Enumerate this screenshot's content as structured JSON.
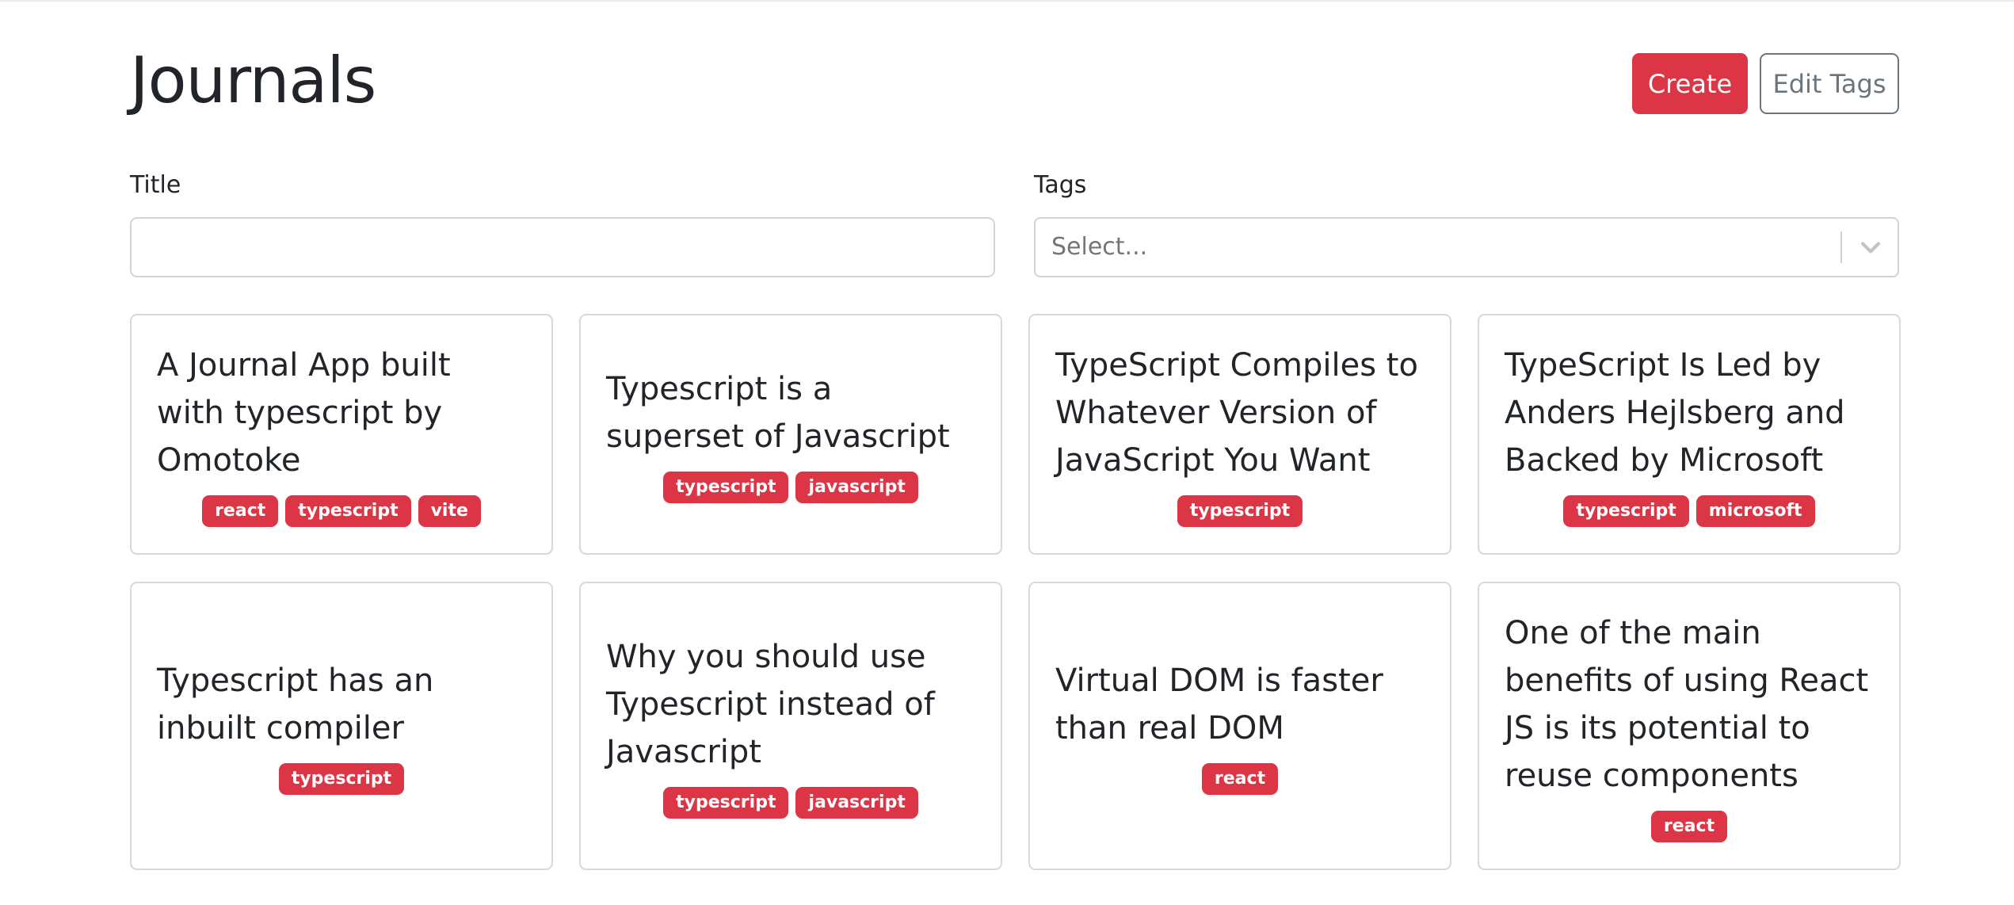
{
  "header": {
    "title": "Journals",
    "create_label": "Create",
    "edit_tags_label": "Edit Tags"
  },
  "filters": {
    "title_label": "Title",
    "title_value": "",
    "tags_label": "Tags",
    "tags_placeholder": "Select..."
  },
  "journals": [
    {
      "title": "A Journal App built with typescript by Omotoke",
      "tags": [
        "react",
        "typescript",
        "vite"
      ]
    },
    {
      "title": "Typescript is a superset of Javascript",
      "tags": [
        "typescript",
        "javascript"
      ]
    },
    {
      "title": "TypeScript Compiles to Whatever Version of JavaScript You Want",
      "tags": [
        "typescript"
      ]
    },
    {
      "title": "TypeScript Is Led by Anders Hejlsberg and Backed by Microsoft",
      "tags": [
        "typescript",
        "microsoft"
      ]
    },
    {
      "title": "Typescript has an inbuilt compiler",
      "tags": [
        "typescript"
      ]
    },
    {
      "title": "Why you should use Typescript instead of Javascript",
      "tags": [
        "typescript",
        "javascript"
      ]
    },
    {
      "title": "Virtual DOM is faster than real DOM",
      "tags": [
        "react"
      ]
    },
    {
      "title": "One of the main benefits of using React JS is its potential to reuse components",
      "tags": [
        "react"
      ]
    }
  ],
  "colors": {
    "accent": "#dc3545",
    "secondary": "#6c757d",
    "border": "#d6d8db"
  },
  "icons": {
    "tags_dropdown": "chevron-down-icon"
  }
}
